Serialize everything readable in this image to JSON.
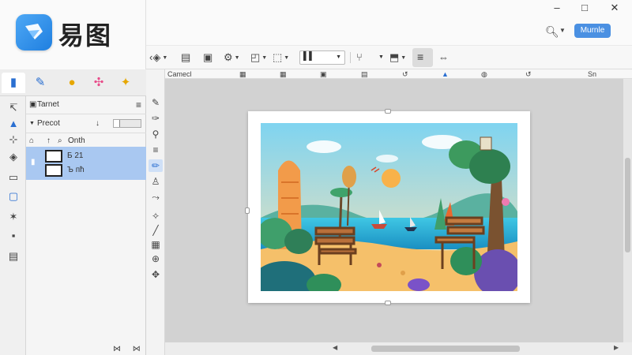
{
  "app": {
    "logo_text": "易图",
    "window_controls": {
      "minimize": "–",
      "maximize": "□",
      "close": "✕"
    }
  },
  "top_bar": {
    "search_icon": "search-icon",
    "profile_label": "Murnle"
  },
  "toolbar": {
    "icons": [
      "rotate-icon",
      "clipboard-icon",
      "copy-icon",
      "settings-icon",
      "crop-icon",
      "select-icon",
      "align-icon",
      "chair-icon",
      "export-icon",
      "menu-icon",
      "arrows-icon"
    ]
  },
  "ruler": {
    "label": "Camecl",
    "items": [
      "Sn"
    ]
  },
  "left_tabs": [
    "document-tab",
    "tools-tab",
    "badge-tab",
    "effects-tab",
    "stickers-tab"
  ],
  "layers_panel": {
    "header_label": "Tarnet",
    "preset_label": "Precot",
    "group_label": "Onth",
    "layers": [
      {
        "name": "Б 21"
      },
      {
        "name": "Ъ пћ"
      }
    ]
  },
  "colors": {
    "accent": "#4a90e2",
    "selection": "#a9c8f1",
    "canvas_bg": "#d2d2d2"
  }
}
